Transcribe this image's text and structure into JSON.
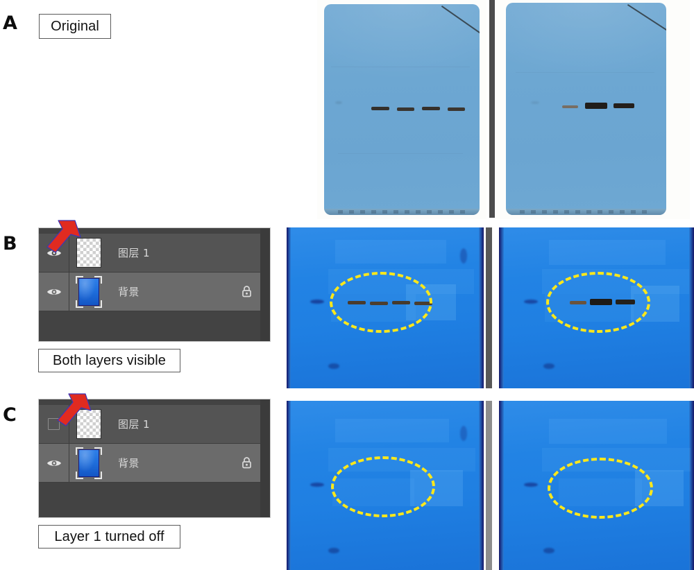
{
  "figure": {
    "title": "Western blot layer-inspection forensics figure",
    "background_color": "#ffffff",
    "panels": [
      {
        "letter": "A",
        "caption": "Original"
      },
      {
        "letter": "B",
        "caption": "Both layers visible"
      },
      {
        "letter": "C",
        "caption": "Layer 1 turned off"
      }
    ]
  },
  "panel_a": {
    "letter": "A",
    "caption": "Original",
    "description": "Unmodified scanned blot films, light blue membrane background",
    "blots": [
      {
        "name": "left-original-blot",
        "band_count": 4,
        "band_intensities": [
          "medium",
          "medium",
          "medium",
          "medium"
        ]
      },
      {
        "name": "right-original-blot",
        "band_count": 3,
        "band_intensities": [
          "faint",
          "dark",
          "dark"
        ]
      }
    ]
  },
  "panel_b": {
    "letter": "B",
    "caption": "Both layers visible",
    "layers_panel": {
      "name": "photoshop-layers-panel",
      "rows": [
        {
          "name": "图层 1",
          "visible": true,
          "visibility_icon": "eye-icon",
          "thumbnail": "transparent-checkerboard",
          "selected": false,
          "locked": false
        },
        {
          "name": "背景",
          "visible": true,
          "visibility_icon": "eye-icon",
          "thumbnail": "blue-membrane",
          "selected": true,
          "locked": true,
          "lock_icon": "lock-icon"
        }
      ]
    },
    "annotation": {
      "name": "red-arrow",
      "color": "#e02b20",
      "points_to": "layer-1-visibility-toggle"
    },
    "blots": [
      {
        "name": "left-enhanced-blot",
        "band_count": 4,
        "highlight": "yellow-dashed-ellipse",
        "highlight_color": "#ffe81a"
      },
      {
        "name": "right-enhanced-blot",
        "band_count": 3,
        "highlight": "yellow-dashed-ellipse",
        "highlight_color": "#ffe81a"
      }
    ]
  },
  "panel_c": {
    "letter": "C",
    "caption": "Layer 1 turned off",
    "layers_panel": {
      "name": "photoshop-layers-panel",
      "rows": [
        {
          "name": "图层 1",
          "visible": false,
          "visibility_icon": "empty-checkbox",
          "thumbnail": "transparent-checkerboard",
          "selected": false,
          "locked": false
        },
        {
          "name": "背景",
          "visible": true,
          "visibility_icon": "eye-icon",
          "thumbnail": "blue-membrane",
          "selected": true,
          "locked": true,
          "lock_icon": "lock-icon"
        }
      ]
    },
    "annotation": {
      "name": "red-arrow",
      "color": "#e02b20",
      "points_to": "layer-1-visibility-toggle"
    },
    "blots": [
      {
        "name": "left-blot-bands-removed",
        "band_count": 0,
        "highlight": "yellow-dashed-ellipse",
        "highlight_color": "#ffe81a",
        "note": "bands absent — blank membrane inside ellipse"
      },
      {
        "name": "right-blot-bands-removed",
        "band_count": 0,
        "highlight": "yellow-dashed-ellipse",
        "highlight_color": "#ffe81a",
        "note": "bands absent — blank membrane inside ellipse"
      }
    ]
  },
  "colors": {
    "panel_bg": "#434343",
    "row_normal": "#545454",
    "row_selected": "#6b6b6b",
    "layer_text": "#d9d9d9",
    "arrow_red": "#e02b20",
    "highlight_yellow": "#ffe81a",
    "membrane_light": "#6ea8d3",
    "membrane_enhanced": "#2283e4"
  }
}
